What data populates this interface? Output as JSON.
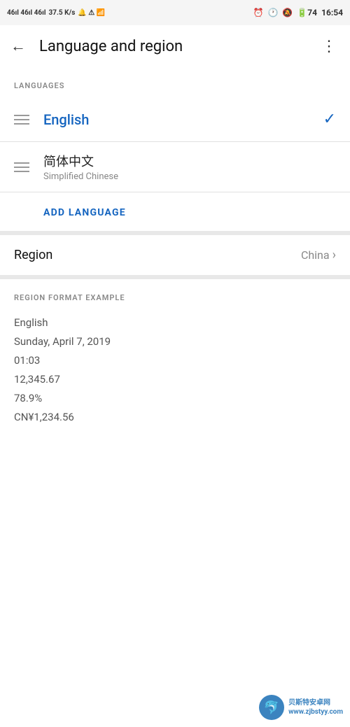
{
  "statusBar": {
    "leftText": "46  46  46",
    "speed": "37.5 K/s",
    "time": "16:54"
  },
  "toolbar": {
    "backIcon": "←",
    "title": "Language and region",
    "moreIcon": "⋮"
  },
  "languages": {
    "sectionLabel": "LANGUAGES",
    "items": [
      {
        "name": "English",
        "subtitle": "",
        "isPrimary": true,
        "hasCheck": true
      },
      {
        "name": "简体中文",
        "subtitle": "Simplified Chinese",
        "isPrimary": false,
        "hasCheck": false
      }
    ],
    "addLabel": "ADD LANGUAGE"
  },
  "region": {
    "label": "Region",
    "value": "China",
    "chevron": "›"
  },
  "regionFormat": {
    "sectionLabel": "REGION FORMAT EXAMPLE",
    "lines": [
      "English",
      "Sunday, April 7, 2019",
      "01:03",
      "12,345.67",
      "78.9%",
      "CN¥1,234.56"
    ]
  },
  "watermark": {
    "iconSymbol": "🐬",
    "line1": "贝斯特安卓网",
    "line2": "www.zjbstyy.com"
  }
}
